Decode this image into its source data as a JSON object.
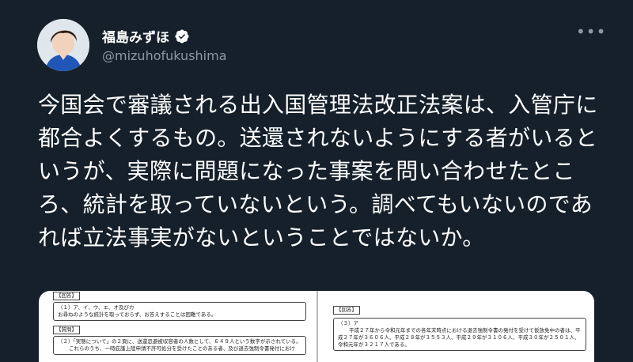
{
  "author": {
    "name": "福島みずほ",
    "handle": "@mizuhofukushima",
    "verified": true
  },
  "menu": {
    "more_label": "•••"
  },
  "tweet": {
    "text": "今国会で審議される出入国管理法改正法案は、入管庁に都合よくするもの。送還されないようにする者がいるというが、実際に問題になった事案を問い合わせたところ、統計を取っていないという。調べてもいないのであれば立法事実がないということではないか。"
  },
  "media": {
    "left_page": {
      "answer_tag": "【回答】",
      "answer_lines": [
        "（１）ア、イ、ウ、エ、オ及びカ",
        "お尋ねのような統計を取っておらず、お答えすることは困難である。"
      ],
      "question_tag": "【質問】",
      "question_lines": [
        "（２）「実態について」の２頁に、送還忌避被収容者の人数として、６４９人という数字が示されている。",
        "これらのうち、一時庇護上陸申請不許可処分を受けたことのある者、及び退去強制令書発付におけ"
      ]
    },
    "right_page": {
      "answer_tag": "【回答】",
      "answer_lines": [
        "（３）ア",
        "平成２７年から令和元年までの各年末時点における退去強制令書の発付を受けて仮放免中の者は、平",
        "成２７年が３６０６人、平成２８年が３５５３人、平成２９年が３１０６人、平成３０年が２５０１人、",
        "令和元年が３２１７人である。"
      ]
    }
  },
  "colors": {
    "background": "#15202b",
    "text": "#ffffff",
    "secondary": "#8b98a5",
    "verified_badge": "#ffffff"
  }
}
